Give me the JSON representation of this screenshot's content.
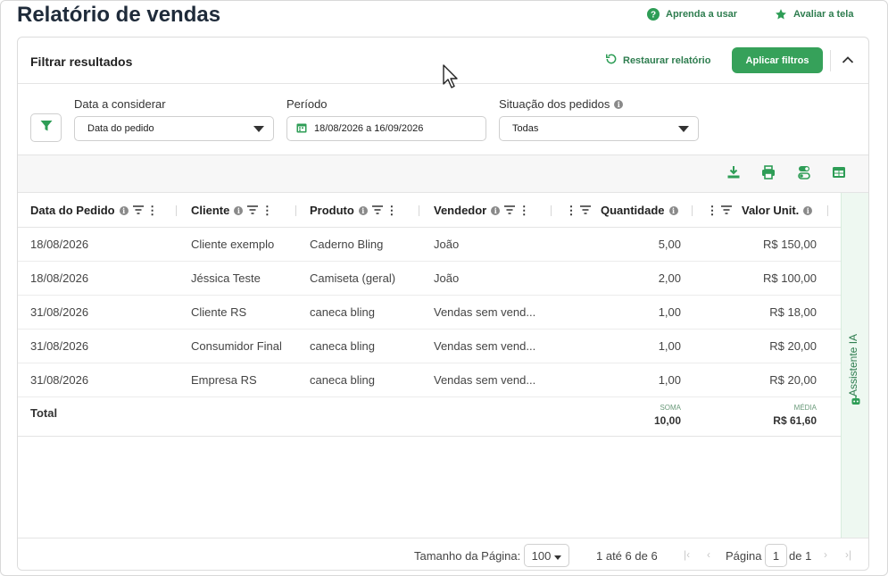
{
  "page": {
    "title": "Relatório de vendas",
    "help_link": "Aprenda a usar",
    "rate_link": "Avaliar a tela"
  },
  "filter_panel": {
    "title": "Filtrar resultados",
    "restore_label": "Restaurar relatório",
    "apply_label": "Aplicar filtros",
    "date_field": {
      "label": "Data a considerar",
      "value": "Data do pedido"
    },
    "period_field": {
      "label": "Período",
      "value": "18/08/2026 a 16/09/2026"
    },
    "status_field": {
      "label": "Situação dos pedidos",
      "value": "Todas"
    }
  },
  "table": {
    "columns": [
      "Data do Pedido",
      "Cliente",
      "Produto",
      "Vendedor",
      "Quantidade",
      "Valor Unit."
    ],
    "rows": [
      [
        "18/08/2026",
        "Cliente exemplo",
        "Caderno Bling",
        "João",
        "5,00",
        "R$ 150,00"
      ],
      [
        "18/08/2026",
        "Jéssica Teste",
        "Camiseta (geral)",
        "João",
        "2,00",
        "R$ 100,00"
      ],
      [
        "31/08/2026",
        "Cliente RS",
        "caneca bling",
        "Vendas sem vend...",
        "1,00",
        "R$ 18,00"
      ],
      [
        "31/08/2026",
        "Consumidor Final",
        "caneca bling",
        "Vendas sem vend...",
        "1,00",
        "R$ 20,00"
      ],
      [
        "31/08/2026",
        "Empresa RS",
        "caneca bling",
        "Vendas sem vend...",
        "1,00",
        "R$ 20,00"
      ]
    ],
    "total": {
      "label": "Total",
      "qty_agg_label": "SOMA",
      "qty_agg_value": "10,00",
      "unit_agg_label": "MÉDIA",
      "unit_agg_value": "R$ 61,60"
    }
  },
  "assistant": {
    "label": "Assistente IA"
  },
  "pagination": {
    "page_size_label": "Tamanho da Página:",
    "page_size_value": "100",
    "range_text": "1 até 6 de 6",
    "page_label": "Página",
    "current_page": "1",
    "of_text": "de 1"
  },
  "colors": {
    "brand_green": "#36a15a",
    "link_green": "#2e7d4f"
  },
  "icons": [
    "question-icon",
    "star-icon",
    "restore-icon",
    "chevron-up-icon",
    "filter-icon",
    "calendar-icon",
    "info-icon",
    "download-icon",
    "print-icon",
    "toggle-icon",
    "table-icon",
    "column-filter-icon",
    "column-menu-icon",
    "robot-icon"
  ]
}
